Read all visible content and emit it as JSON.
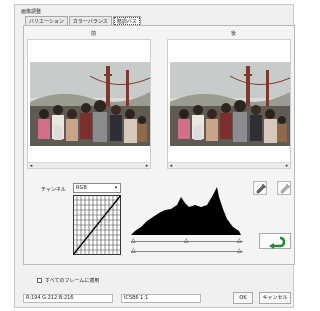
{
  "window": {
    "title": "画像調整",
    "tabs": [
      "バリエーション",
      "カラーバランス",
      "階調パス"
    ],
    "active_tab_index": 2,
    "before_label": "前",
    "after_label": "後",
    "scroll_left": "◂",
    "scroll_right": "▸"
  },
  "controls": {
    "channel_label": "チャンネル",
    "channel_value": "RGB",
    "dropdown_arrow": "▾",
    "checkbox_label": "すべてのフレームに適用",
    "checkbox_checked": false
  },
  "status": {
    "rgb_readout": "R:194 G:212 B:216",
    "code_readout": "ICS86 1:1"
  },
  "buttons": {
    "ok": "OK",
    "cancel": "キャンセル"
  },
  "icons": {
    "eyedropper": "eyedropper-icon",
    "eyedropper2": "eyedropper-icon",
    "reset": "undo-arrow-icon"
  },
  "colors": {
    "accent_arrow": "#1c8a3a"
  }
}
